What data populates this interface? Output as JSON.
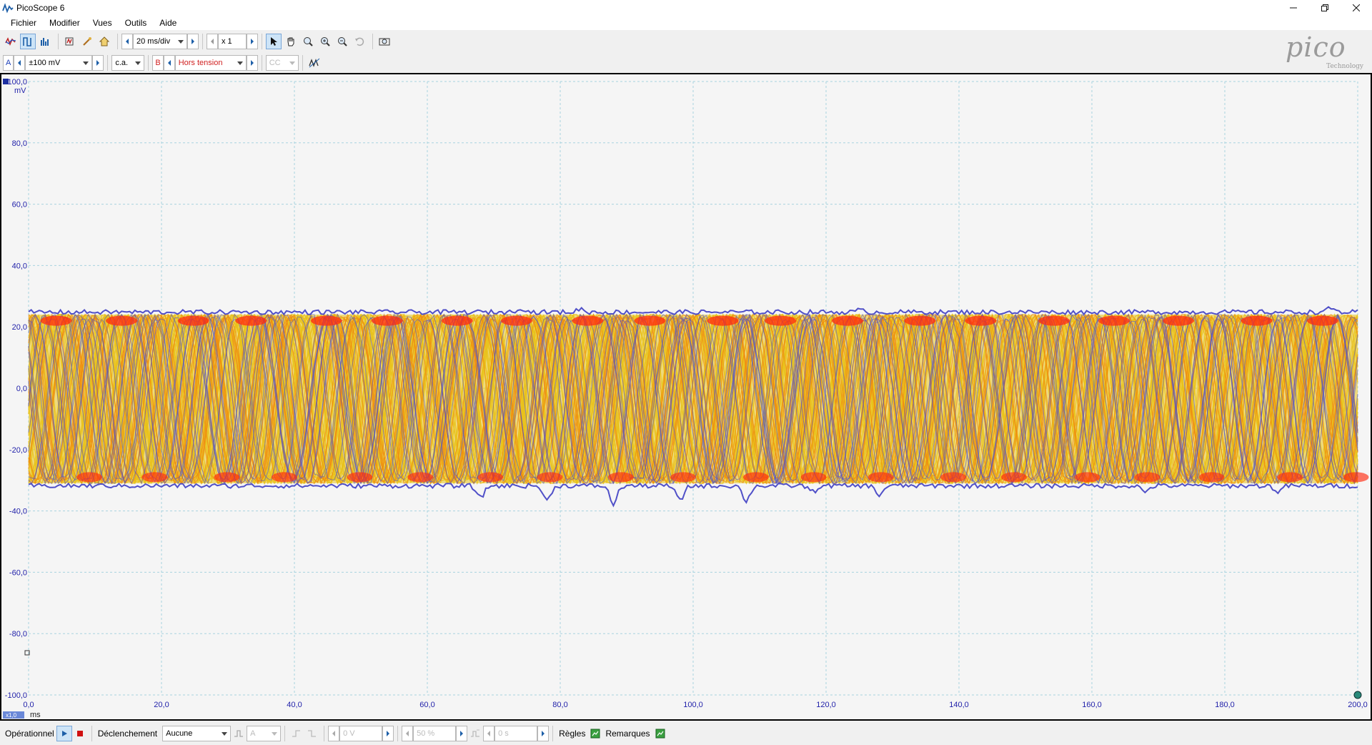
{
  "window": {
    "title": "PicoScope 6",
    "controls": [
      "minimize-icon",
      "restore-icon",
      "close-icon"
    ]
  },
  "menu": [
    "Fichier",
    "Modifier",
    "Vues",
    "Outils",
    "Aide"
  ],
  "toolbar1": {
    "timebase": "20 ms/div",
    "zoom": "x 1"
  },
  "toolbar2": {
    "channel_a": "A",
    "range_a": "±100 mV",
    "coupling_a": "c.a.",
    "channel_b": "B",
    "range_b": "Hors tension",
    "coupling_b": "CC"
  },
  "logo": {
    "text": "pico",
    "sub": "Technology"
  },
  "scope": {
    "y_unit": "mV",
    "y_ticks": [
      "100,0",
      "80,0",
      "60,0",
      "40,0",
      "20,0",
      "0,0",
      "-20,0",
      "-40,0",
      "-60,0",
      "-80,0",
      "-100,0"
    ],
    "x_ticks": [
      "0,0",
      "20,0",
      "40,0",
      "60,0",
      "80,0",
      "100,0",
      "120,0",
      "140,0",
      "160,0",
      "180,0",
      "200,0"
    ],
    "x_unit": "ms",
    "zoom_badge": "x1,0",
    "x_range_ms": [
      0,
      200
    ],
    "y_range_mv": [
      -100,
      100
    ],
    "signal_band_mv": {
      "upper": 24,
      "lower": -31
    },
    "colors": {
      "background": "#f5f5f5",
      "grid": "#a8d4e0",
      "axis_text": "#2222aa",
      "trace_yellow": "#e8c21a",
      "trace_orange": "#f08a10",
      "trace_red": "#ff2a10",
      "trace_blue": "#5050c8"
    }
  },
  "status": {
    "run_state": "Opérationnel",
    "trigger_label": "Déclenchement",
    "trigger_mode": "Aucune",
    "trigger_source": "A",
    "threshold": "0 V",
    "pretrigger": "50 %",
    "delay": "0 s",
    "rulers_label": "Règles",
    "notes_label": "Remarques"
  }
}
